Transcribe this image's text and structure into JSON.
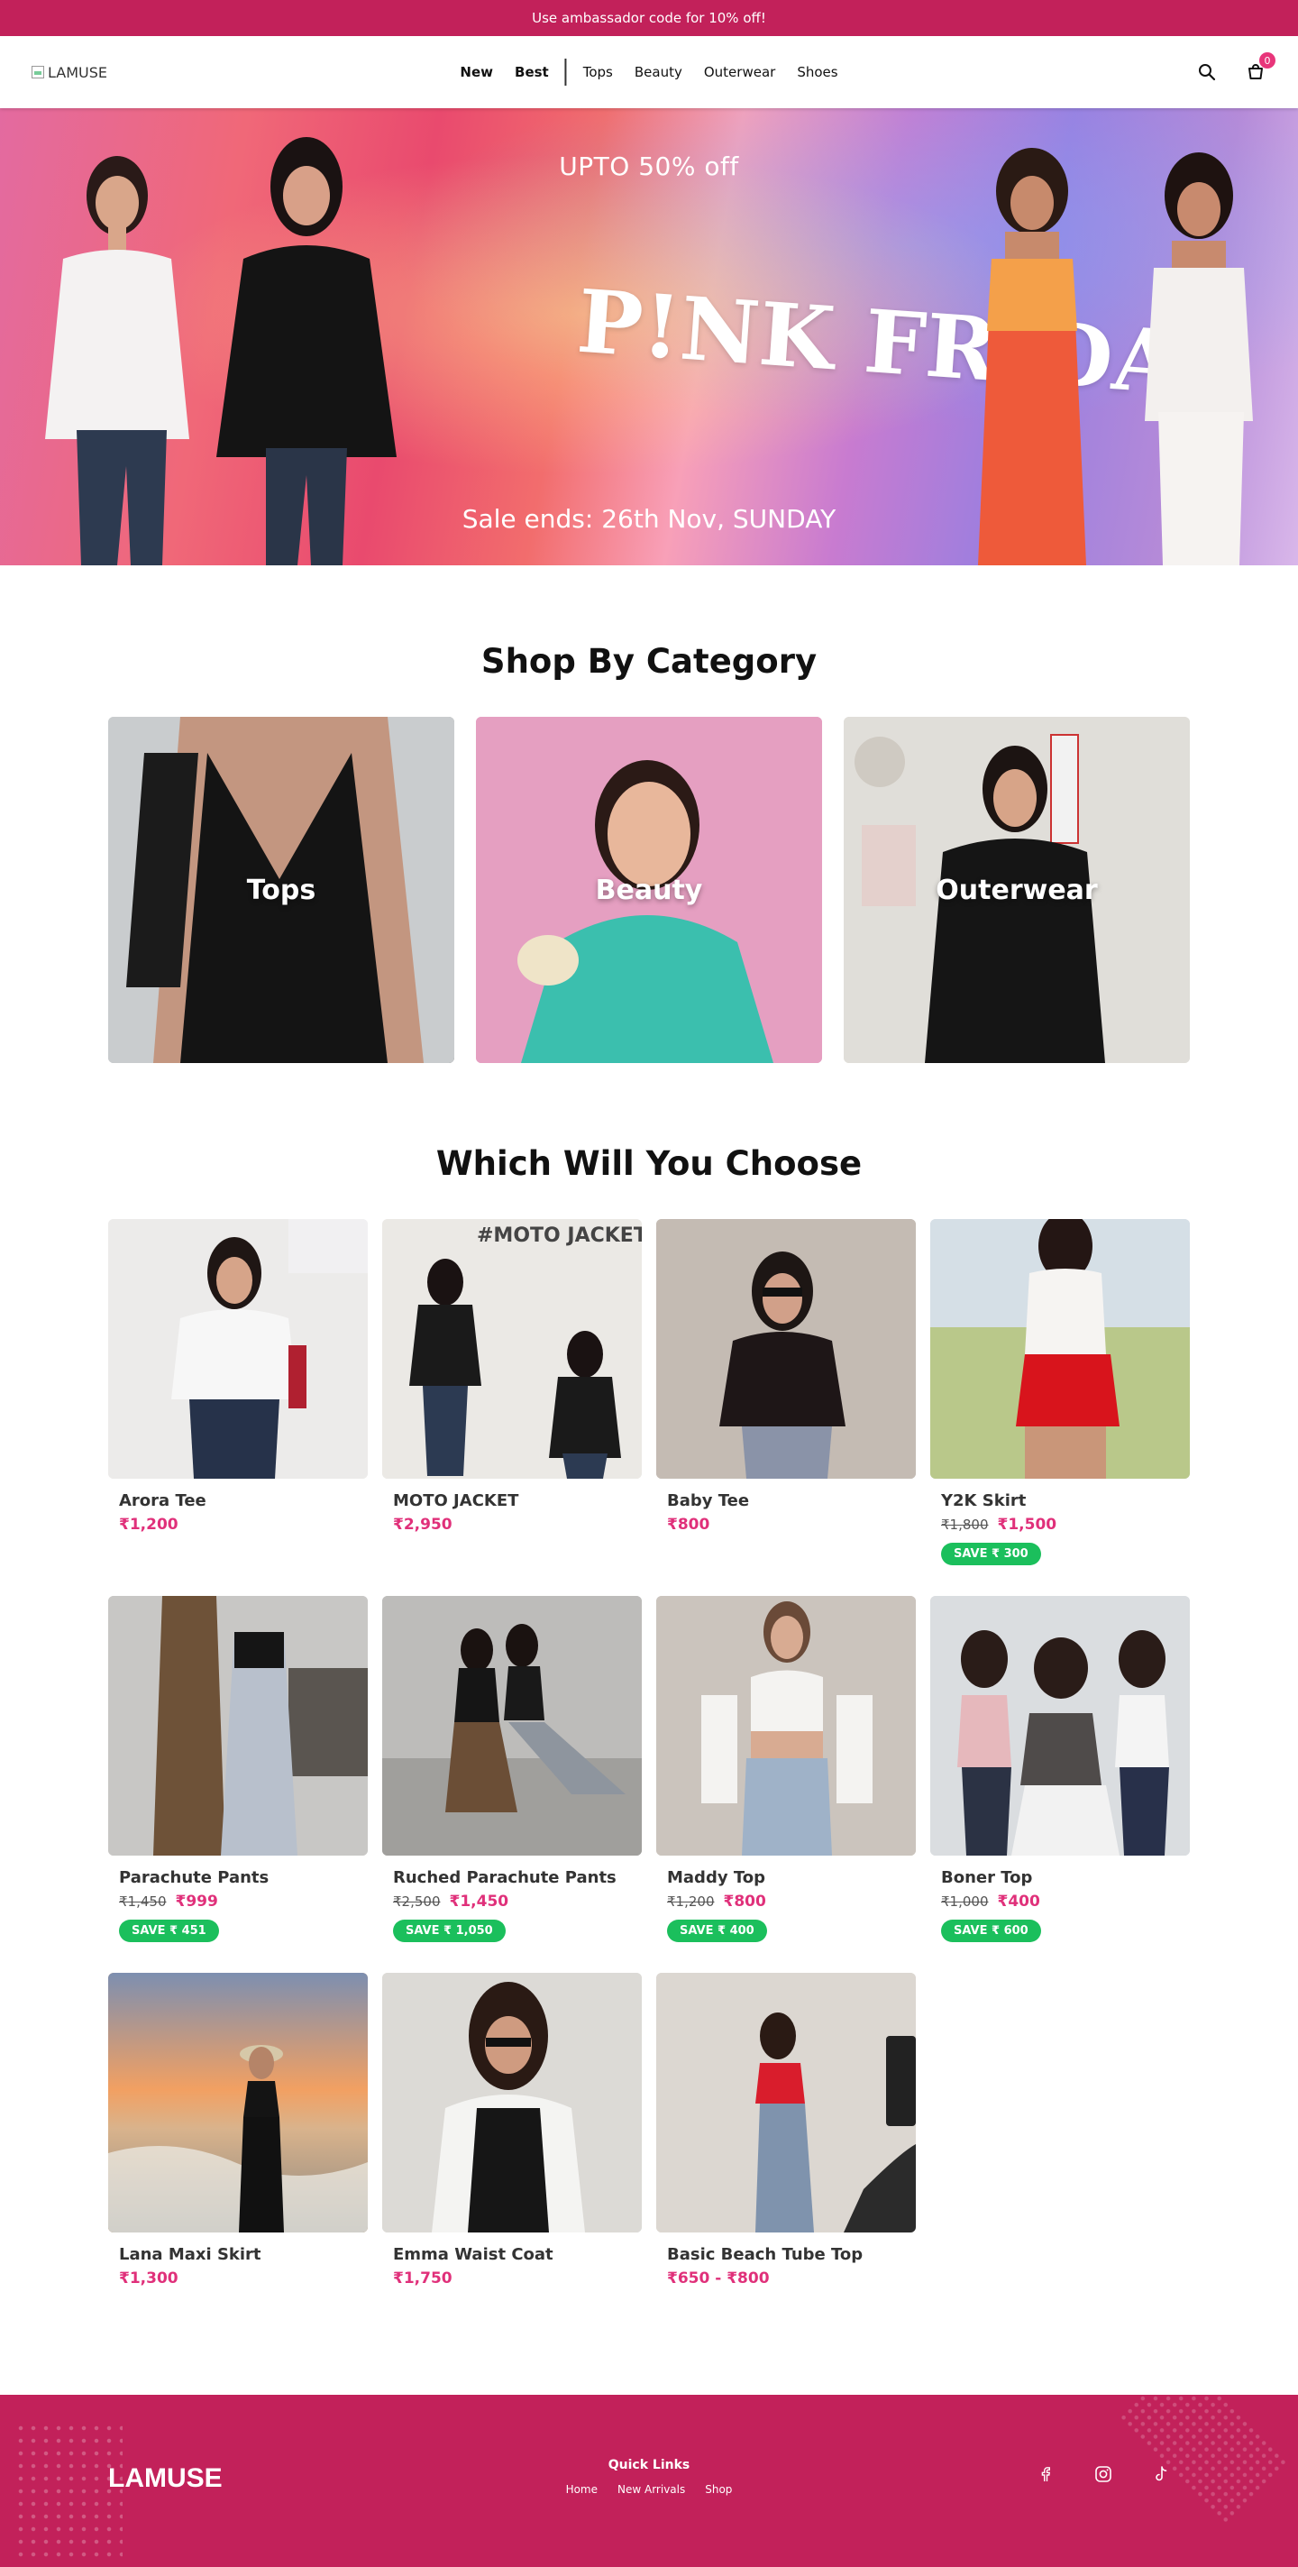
{
  "announcement": "Use ambassador code for 10% off!",
  "header": {
    "logo_alt": "LAMUSE",
    "nav": [
      {
        "label": "New",
        "bold": true
      },
      {
        "label": "Best",
        "bold": true
      },
      {
        "label": "Tops",
        "bold": false
      },
      {
        "label": "Beauty",
        "bold": false
      },
      {
        "label": "Outerwear",
        "bold": false
      },
      {
        "label": "Shoes",
        "bold": false
      }
    ],
    "cart_count": "0",
    "icons": [
      "search-icon",
      "cart-icon"
    ]
  },
  "hero": {
    "subtitle": "UPTO 50% off",
    "title": "P!NK FRIDAY",
    "ends": "Sale ends: 26th Nov, SUNDAY"
  },
  "categories": {
    "title": "Shop By Category",
    "items": [
      {
        "label": "Tops"
      },
      {
        "label": "Beauty"
      },
      {
        "label": "Outerwear"
      }
    ]
  },
  "products": {
    "title": "Which Will You Choose",
    "items": [
      {
        "name": "Arora Tee",
        "price": "₹1,200",
        "old": "",
        "save": ""
      },
      {
        "name": "MOTO JACKET",
        "price": "₹2,950",
        "old": "",
        "save": "",
        "overlay": "#MOTO JACKET"
      },
      {
        "name": "Baby Tee",
        "price": "₹800",
        "old": "",
        "save": ""
      },
      {
        "name": "Y2K Skirt",
        "price": "₹1,500",
        "old": "₹1,800",
        "save": "SAVE ₹ 300"
      },
      {
        "name": "Parachute Pants",
        "price": "₹999",
        "old": "₹1,450",
        "save": "SAVE ₹ 451"
      },
      {
        "name": "Ruched Parachute Pants",
        "price": "₹1,450",
        "old": "₹2,500",
        "save": "SAVE ₹ 1,050"
      },
      {
        "name": "Maddy Top",
        "price": "₹800",
        "old": "₹1,200",
        "save": "SAVE ₹ 400"
      },
      {
        "name": "Boner Top",
        "price": "₹400",
        "old": "₹1,000",
        "save": "SAVE ₹ 600"
      },
      {
        "name": "Lana Maxi Skirt",
        "price": "₹1,300",
        "old": "",
        "save": ""
      },
      {
        "name": "Emma Waist Coat",
        "price": "₹1,750",
        "old": "",
        "save": ""
      },
      {
        "name": "Basic Beach Tube Top",
        "price": "₹650 - ₹800",
        "old": "",
        "save": ""
      }
    ]
  },
  "footer": {
    "logo": "LAMUSE",
    "quick_links_title": "Quick Links",
    "links": [
      "Home",
      "New Arrivals",
      "Shop"
    ],
    "socials": [
      "facebook-icon",
      "instagram-icon",
      "tiktok-icon"
    ]
  },
  "colors": {
    "brand": "#c2215a",
    "price": "#e0307a",
    "save_badge": "#1bbf5c"
  }
}
